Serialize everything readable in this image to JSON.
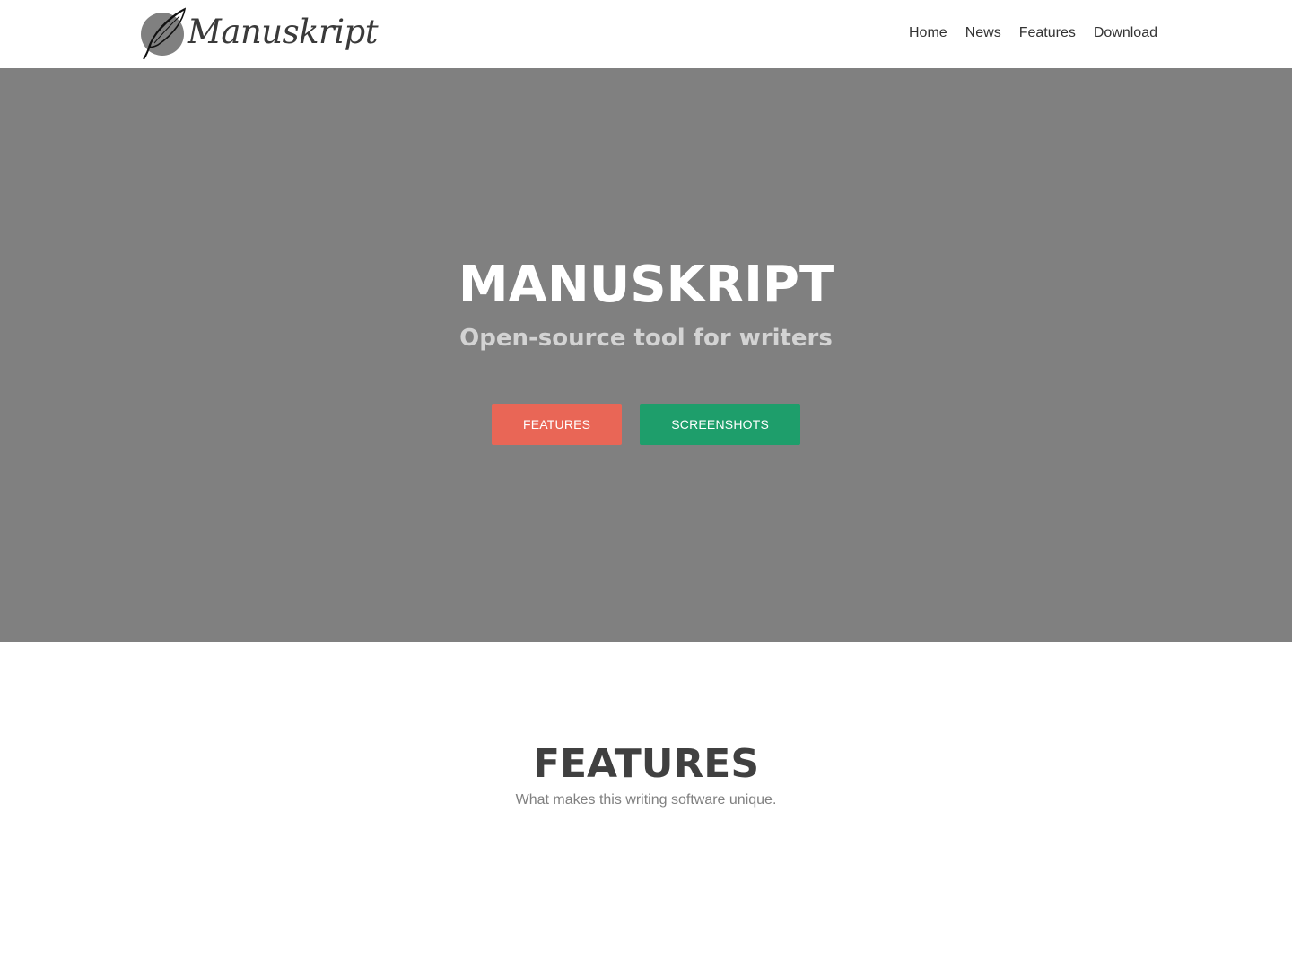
{
  "brand": {
    "logo_icon": "quill-icon",
    "name": "Manuskript"
  },
  "nav": {
    "items": [
      {
        "label": "Home"
      },
      {
        "label": "News"
      },
      {
        "label": "Features"
      },
      {
        "label": "Download"
      }
    ]
  },
  "hero": {
    "title": "MANUSKRIPT",
    "subtitle": "Open-source tool for writers",
    "buttons": [
      {
        "label": "FEATURES",
        "color": "#e96656"
      },
      {
        "label": "SCREENSHOTS",
        "color": "#1e9e6b"
      }
    ],
    "background": "#808080"
  },
  "features_section": {
    "title": "FEATURES",
    "subtitle": "What makes this writing software unique."
  }
}
